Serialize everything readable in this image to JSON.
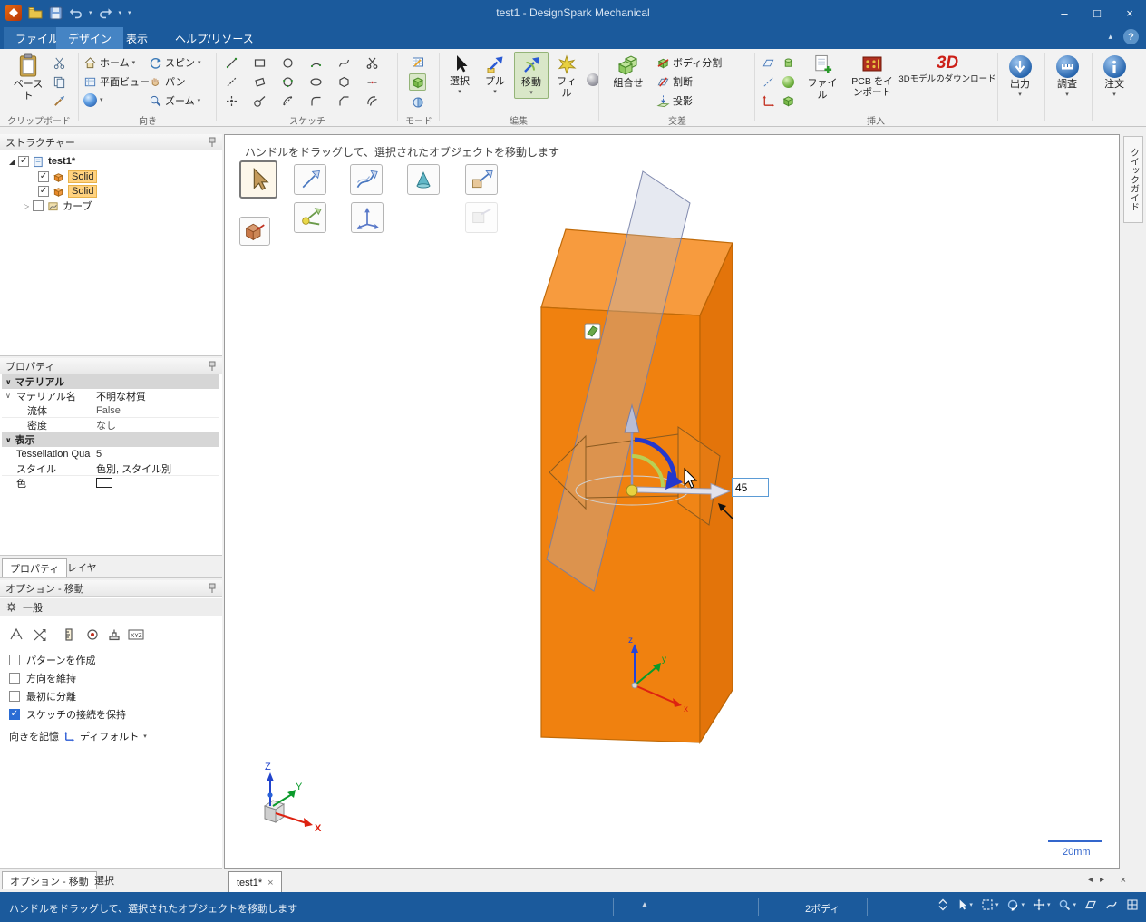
{
  "titlebar": {
    "title": "test1 - DesignSpark Mechanical"
  },
  "tabs": {
    "file": "ファイル",
    "design": "デザイン",
    "view": "表示",
    "help": "ヘルプ/リソース"
  },
  "icons": {
    "dropdown": "▾",
    "up": "▲",
    "collapse": "▴",
    "help": "?",
    "minimize": "–",
    "maximize": "□",
    "close": "×",
    "expander_open": "◢",
    "expander_closed": "▷",
    "section_chevron": "∨",
    "check": "✓",
    "tab_prev": "◂",
    "tab_next": "▸"
  },
  "ribbon": {
    "clipboard": {
      "label": "クリップボード",
      "paste": "ペースト"
    },
    "orient": {
      "label": "向き",
      "home": "ホーム",
      "spin": "スピン",
      "plan": "平面ビュー",
      "pan": "パン",
      "zoom": "ズーム"
    },
    "sketch": {
      "label": "スケッチ"
    },
    "mode": {
      "label": "モード"
    },
    "edit": {
      "label": "編集",
      "select": "選択",
      "pull": "プル",
      "move": "移動",
      "fill": "フィル"
    },
    "intersect": {
      "label": "交差",
      "combine": "組合せ",
      "split_body": "ボディ分割",
      "split_face": "割断",
      "project": "投影"
    },
    "insert": {
      "label": "挿入",
      "file": "ファイル",
      "pcb": "PCB をインポート",
      "model3d": "3Dモデルのダウンロード",
      "logo3d": "3D"
    },
    "output": "出力",
    "inspect": "調査",
    "order": "注文"
  },
  "structure": {
    "title": "ストラクチャー",
    "root": "test1*",
    "items": [
      {
        "label": "Solid",
        "checked": true,
        "selected": true
      },
      {
        "label": "Solid",
        "checked": true,
        "selected": true
      },
      {
        "label": "カーブ",
        "checked": false,
        "selected": false
      }
    ]
  },
  "properties": {
    "title": "プロパティ",
    "material_section": "マテリアル",
    "material_rows": [
      {
        "name": "マテリアル名",
        "value": "不明な材質"
      },
      {
        "name": "流体",
        "value": "False"
      },
      {
        "name": "密度",
        "value": "なし"
      }
    ],
    "display_section": "表示",
    "display_rows": [
      {
        "name": "Tessellation Qua",
        "value": "5"
      },
      {
        "name": "スタイル",
        "value": "色別, スタイル別"
      },
      {
        "name": "色",
        "value": ""
      }
    ],
    "tab_properties": "プロパティ",
    "tab_layers": "レイヤ"
  },
  "options": {
    "title": "オプション - 移動",
    "general": "一般",
    "xyz": "XYZ",
    "checkboxes": [
      {
        "label": "パターンを作成",
        "checked": false
      },
      {
        "label": "方向を維持",
        "checked": false
      },
      {
        "label": "最初に分離",
        "checked": false
      },
      {
        "label": "スケッチの接続を保持",
        "checked": true
      }
    ],
    "remember": "向きを記憶",
    "default_value": "ディフォルト"
  },
  "footer_tabs": {
    "options": "オプション - 移動",
    "select": "選択"
  },
  "viewport": {
    "hint": "ハンドルをドラッグして、選択されたオブジェクトを移動します",
    "dimension": "45",
    "scale": "20mm",
    "doc_tab": "test1*",
    "axis": {
      "x": "x",
      "y": "y",
      "z": "z"
    },
    "view_axis": {
      "x": "X",
      "y": "Y",
      "z": "Z"
    }
  },
  "quick_guide": "クイックガイド",
  "statusbar": {
    "message": "ハンドルをドラッグして、選択されたオブジェクトを移動します",
    "bodies": "2ボディ"
  },
  "colors": {
    "titlebar": "#1b5a9c",
    "box_orange": "#f0810f",
    "move_highlight": "#d9e7c8",
    "selection_highlight": "#ffd27f"
  }
}
